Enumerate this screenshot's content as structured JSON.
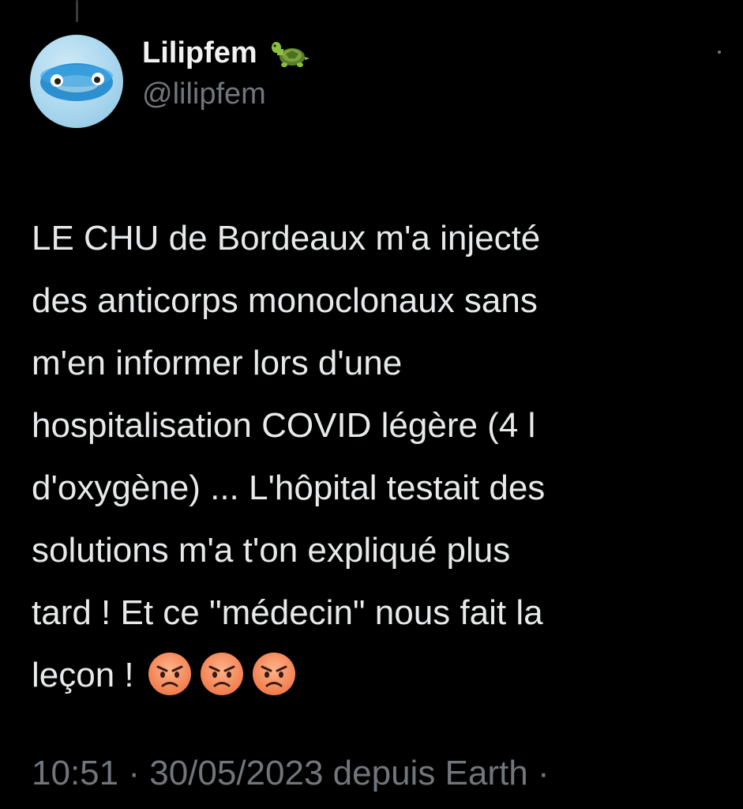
{
  "user": {
    "display_name": "Lilipfem",
    "handle": "@lilipfem",
    "badge_icon": "turtle-emoji",
    "avatar": "avatar-image"
  },
  "tweet": {
    "text": "LE CHU de Bordeaux m'a injecté\ndes anticorps monoclonaux sans\nm'en informer lors d'une\nhospitalisation COVID légère (4 l\nd'oxygène) ... L'hôpital testait des\nsolutions m'a t'on expliqué plus\ntard ! Et ce \"médecin\" nous fait la\nleçon !",
    "emojis": [
      "angry-face-emoji",
      "angry-face-emoji",
      "angry-face-emoji"
    ]
  },
  "meta": {
    "time": "10:51",
    "sep1": " · ",
    "date": "30/05/2023",
    "source": " depuis Earth",
    "sep2": " ·"
  },
  "colors": {
    "background": "#000000",
    "text": "#e7e9ea",
    "muted": "#71767b"
  }
}
